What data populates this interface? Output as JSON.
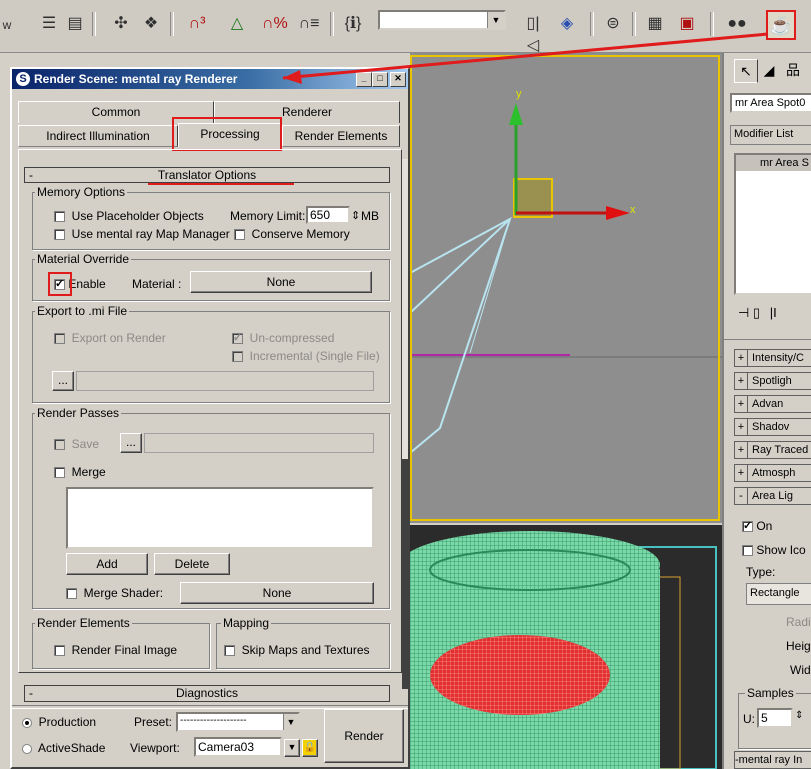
{
  "toolbar": {
    "icons": [
      "arrow-icon",
      "select-region-icon",
      "select-by-name-icon",
      "move-icon",
      "snap-icon",
      "angle-snap-icon",
      "percent-snap-icon",
      "spinner-snap-icon",
      "named-selection-icon",
      "mirror-icon",
      "align-icon",
      "layer-manager-icon",
      "curve-editor-icon",
      "schematic-icon",
      "material-editor-icon",
      "render-scene-icon"
    ]
  },
  "dialog": {
    "title": "Render Scene: mental ray Renderer",
    "tabs": {
      "common": "Common",
      "renderer": "Renderer",
      "indirect": "Indirect Illumination",
      "processing": "Processing",
      "render_elements": "Render Elements"
    },
    "translator_options": {
      "header": "Translator Options",
      "memory_options": {
        "title": "Memory Options",
        "use_placeholder": "Use Placeholder Objects",
        "memory_limit_label": "Memory Limit:",
        "memory_limit_value": "650",
        "memory_unit": "MB",
        "use_map_manager": "Use mental ray Map Manager",
        "conserve_memory": "Conserve Memory"
      },
      "material_override": {
        "title": "Material Override",
        "enable": "Enable",
        "enable_checked": true,
        "material_label": "Material :",
        "material_value": "None"
      },
      "export_mi": {
        "title": "Export to .mi File",
        "export_on_render": "Export on Render",
        "uncompressed": "Un-compressed",
        "incremental": "Incremental (Single File)",
        "browse": "..."
      },
      "render_passes": {
        "title": "Render Passes",
        "save": "Save",
        "browse": "...",
        "merge": "Merge",
        "add": "Add",
        "delete": "Delete",
        "merge_shader": "Merge Shader:",
        "merge_shader_value": "None"
      },
      "render_elements": {
        "title": "Render Elements",
        "render_final_image": "Render Final Image"
      },
      "mapping": {
        "title": "Mapping",
        "skip_maps": "Skip Maps and Textures"
      }
    },
    "diagnostics": {
      "sign": "-",
      "header": "Diagnostics"
    },
    "footer": {
      "production": "Production",
      "activeshade": "ActiveShade",
      "preset_label": "Preset:",
      "preset_value": "--------------------",
      "viewport_label": "Viewport:",
      "viewport_value": "Camera03",
      "render_button": "Render"
    }
  },
  "viewport": {
    "axis_y": "y",
    "axis_x": "x"
  },
  "command_panel": {
    "object_name": "mr Area Spot0",
    "modifier_list": "Modifier List",
    "stack_item": "mr Area S",
    "rollouts": [
      {
        "sign": "+",
        "label": "Intensity/C"
      },
      {
        "sign": "+",
        "label": "Spotligh"
      },
      {
        "sign": "+",
        "label": "Advan"
      },
      {
        "sign": "+",
        "label": "Shadov"
      },
      {
        "sign": "+",
        "label": "Ray Traced"
      },
      {
        "sign": "+",
        "label": "Atmosph"
      },
      {
        "sign": "-",
        "label": "Area Lig"
      }
    ],
    "on_label": "On",
    "show_icon": "Show Ico",
    "type_label": "Type:",
    "type_value": "Rectangle",
    "radius_label": "Radi",
    "height_label": "Heig",
    "width_label": "Wid",
    "samples_title": "Samples",
    "u_label": "U:",
    "u_value": "5",
    "bottom_rollout": "-mental ray In"
  },
  "colors": {
    "highlight_red": "#e01b1b",
    "viewport_active": "#e9c400",
    "title_bar": "#0a246a"
  }
}
